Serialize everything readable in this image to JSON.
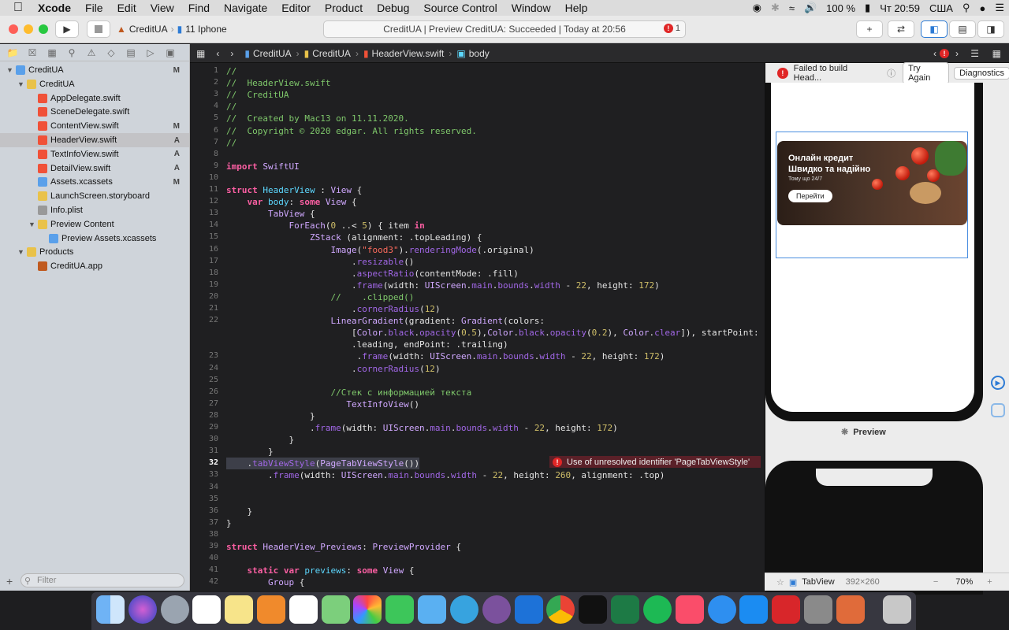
{
  "menubar": {
    "app": "Xcode",
    "items": [
      "File",
      "Edit",
      "View",
      "Find",
      "Navigate",
      "Editor",
      "Product",
      "Debug",
      "Source Control",
      "Window",
      "Help"
    ],
    "battery": "100 %",
    "clock": "Чт 20:59",
    "keyboard": "США"
  },
  "toolbar": {
    "scheme": "CreditUA",
    "device": "11 Iphone",
    "activity": "CreditUA | Preview CreditUA: Succeeded | Today at 20:56",
    "error_count": "1"
  },
  "navigator": {
    "rows": [
      {
        "label": "CreditUA",
        "indent": 0,
        "disc": "▼",
        "icon": "project",
        "status": "M"
      },
      {
        "label": "CreditUA",
        "indent": 1,
        "disc": "▼",
        "icon": "folder",
        "status": ""
      },
      {
        "label": "AppDelegate.swift",
        "indent": 2,
        "disc": "",
        "icon": "swift",
        "status": ""
      },
      {
        "label": "SceneDelegate.swift",
        "indent": 2,
        "disc": "",
        "icon": "swift",
        "status": ""
      },
      {
        "label": "ContentView.swift",
        "indent": 2,
        "disc": "",
        "icon": "swift",
        "status": "M"
      },
      {
        "label": "HeaderView.swift",
        "indent": 2,
        "disc": "",
        "icon": "swift",
        "status": "A",
        "selected": true
      },
      {
        "label": "TextInfoView.swift",
        "indent": 2,
        "disc": "",
        "icon": "swift",
        "status": "A"
      },
      {
        "label": "DetailView.swift",
        "indent": 2,
        "disc": "",
        "icon": "swift",
        "status": "A"
      },
      {
        "label": "Assets.xcassets",
        "indent": 2,
        "disc": "",
        "icon": "assets",
        "status": "M"
      },
      {
        "label": "LaunchScreen.storyboard",
        "indent": 2,
        "disc": "",
        "icon": "storyboard",
        "status": ""
      },
      {
        "label": "Info.plist",
        "indent": 2,
        "disc": "",
        "icon": "plist",
        "status": ""
      },
      {
        "label": "Preview Content",
        "indent": 2,
        "disc": "▼",
        "icon": "folder",
        "status": ""
      },
      {
        "label": "Preview Assets.xcassets",
        "indent": 3,
        "disc": "",
        "icon": "assets",
        "status": ""
      },
      {
        "label": "Products",
        "indent": 1,
        "disc": "▼",
        "icon": "folder",
        "status": ""
      },
      {
        "label": "CreditUA.app",
        "indent": 2,
        "disc": "",
        "icon": "app",
        "status": ""
      }
    ],
    "filter_placeholder": "Filter"
  },
  "breadcrumb": [
    "CreditUA",
    "CreditUA",
    "HeaderView.swift",
    "body"
  ],
  "editor": {
    "lines": [
      [
        "1",
        "//"
      ],
      [
        "2",
        "//  HeaderView.swift"
      ],
      [
        "3",
        "//  CreditUA"
      ],
      [
        "4",
        "//"
      ],
      [
        "5",
        "//  Created by Mac13 on 11.11.2020."
      ],
      [
        "6",
        "//  Copyright © 2020 edgar. All rights reserved."
      ],
      [
        "7",
        "//"
      ],
      [
        "8",
        ""
      ],
      [
        "9",
        "import SwiftUI"
      ],
      [
        "10",
        ""
      ],
      [
        "11",
        "struct HeaderView : View {"
      ],
      [
        "12",
        "    var body: some View {"
      ],
      [
        "13",
        "        TabView {"
      ],
      [
        "14",
        "            ForEach(0 ..< 5) { item in"
      ],
      [
        "15",
        "                ZStack (alignment: .topLeading) {"
      ],
      [
        "16",
        "                    Image(\"food3\").renderingMode(.original)"
      ],
      [
        "17",
        "                        .resizable()"
      ],
      [
        "18",
        "                        .aspectRatio(contentMode: .fill)"
      ],
      [
        "19",
        "                        .frame(width: UIScreen.main.bounds.width - 22, height: 172)"
      ],
      [
        "20",
        "                    //    .clipped()"
      ],
      [
        "21",
        "                        .cornerRadius(12)"
      ],
      [
        "22",
        "                    LinearGradient(gradient: Gradient(colors:"
      ],
      [
        "",
        "                        [Color.black.opacity(0.5),Color.black.opacity(0.2), Color.clear]), startPoint:"
      ],
      [
        "",
        "                        .leading, endPoint: .trailing)"
      ],
      [
        "23",
        "                         .frame(width: UIScreen.main.bounds.width - 22, height: 172)"
      ],
      [
        "24",
        "                        .cornerRadius(12)"
      ],
      [
        "25",
        ""
      ],
      [
        "26",
        "                    //Стек с информацией текста"
      ],
      [
        "27",
        "                       TextInfoView()"
      ],
      [
        "28",
        "                }"
      ],
      [
        "29",
        "                .frame(width: UIScreen.main.bounds.width - 22, height: 172)"
      ],
      [
        "30",
        "            }"
      ],
      [
        "31",
        "        }"
      ],
      [
        "32",
        "    .tabViewStyle(PageTabViewStyle())"
      ],
      [
        "33",
        "        .frame(width: UIScreen.main.bounds.width - 22, height: 260, alignment: .top)"
      ],
      [
        "34",
        ""
      ],
      [
        "35",
        ""
      ],
      [
        "36",
        "    }"
      ],
      [
        "37",
        "}"
      ],
      [
        "38",
        ""
      ],
      [
        "39",
        "struct HeaderView_Previews: PreviewProvider {"
      ],
      [
        "40",
        ""
      ],
      [
        "41",
        "    static var previews: some View {"
      ],
      [
        "42",
        "        Group {"
      ]
    ],
    "error_message": "Use of unresolved identifier 'PageTabViewStyle'"
  },
  "canvas": {
    "fail_msg": "Failed to build Head...",
    "try_again": "Try Again",
    "diagnostics": "Diagnostics",
    "banner_line1": "Онлайн кредит",
    "banner_line2": "Швидко та надійно",
    "banner_sub": "Тому що 24/7",
    "banner_button": "Перейти",
    "preview_label": "Preview",
    "bottom_name": "TabView",
    "bottom_size": "392×260",
    "zoom": "70%"
  },
  "colors": {
    "error": "#e02626",
    "selection": "#4a8fe0",
    "comment": "#7fc86b",
    "keyword": "#fc5fa3"
  }
}
